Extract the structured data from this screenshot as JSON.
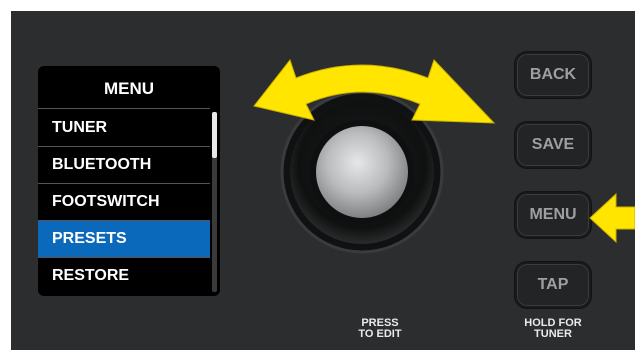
{
  "menu": {
    "title": "MENU",
    "items": [
      {
        "label": "TUNER"
      },
      {
        "label": "BLUETOOTH"
      },
      {
        "label": "FOOTSWITCH"
      },
      {
        "label": "PRESETS",
        "selected": true
      },
      {
        "label": "RESTORE"
      }
    ],
    "selected_color": "#0b69bb"
  },
  "knob": {
    "caption_line1": "PRESS",
    "caption_line2": "TO EDIT",
    "arrow_color": "#ffe500",
    "arrow_icon": "rotate-both-ways-arrow-icon"
  },
  "buttons": {
    "back": "BACK",
    "save": "SAVE",
    "menu": "MENU",
    "tap": "TAP",
    "tap_caption_line1": "HOLD FOR",
    "tap_caption_line2": "TUNER"
  },
  "indicator": {
    "arrow_color": "#ffe500",
    "icon": "left-pointing-arrow-icon"
  }
}
